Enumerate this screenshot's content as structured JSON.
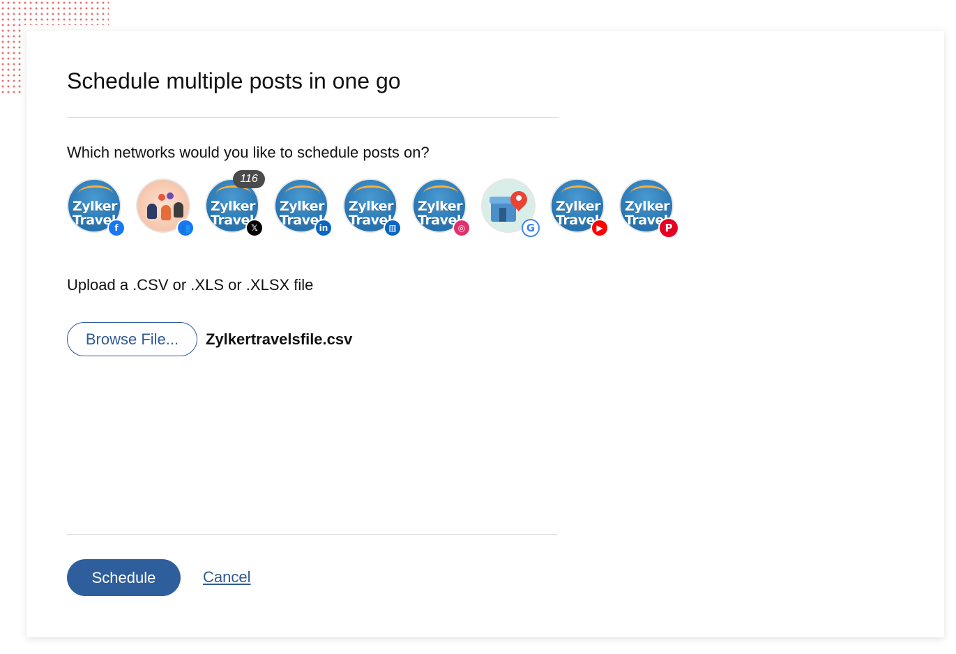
{
  "title": "Schedule multiple posts in one go",
  "networks_question": "Which networks would you like to schedule posts on?",
  "networks": [
    {
      "avatar": "Zylker Travel",
      "network": "facebook-icon",
      "badge_glyph": "f",
      "badge_color": "#1877f2"
    },
    {
      "avatar": "group-illustration",
      "network": "facebook-group-icon",
      "badge_glyph": "👥",
      "badge_color": "#1877f2"
    },
    {
      "avatar": "Zylker Travel",
      "network": "x-icon",
      "badge_glyph": "𝕏",
      "badge_color": "#000000",
      "count": "116"
    },
    {
      "avatar": "Zylker Travel",
      "network": "linkedin-icon",
      "badge_glyph": "in",
      "badge_color": "#0a66c2"
    },
    {
      "avatar": "Zylker Travel",
      "network": "linkedin-page-icon",
      "badge_glyph": "▥",
      "badge_color": "#0a66c2"
    },
    {
      "avatar": "Zylker Travel",
      "network": "instagram-icon",
      "badge_glyph": "◎",
      "badge_color": "#e1306c"
    },
    {
      "avatar": "store-map-pin",
      "network": "google-business-icon",
      "badge_glyph": "G",
      "badge_color": "#4285f4"
    },
    {
      "avatar": "Zylker Travel",
      "network": "youtube-icon",
      "badge_glyph": "▶",
      "badge_color": "#ff0000"
    },
    {
      "avatar": "Zylker Travel",
      "network": "pinterest-icon",
      "badge_glyph": "P",
      "badge_color": "#e60023"
    }
  ],
  "upload_label": "Upload a .CSV or .XLS or .XLSX file",
  "browse_label": "Browse File...",
  "file_name": "Zylkertravelsfile.csv",
  "schedule_label": "Schedule",
  "cancel_label": "Cancel",
  "colors": {
    "primary": "#2f5e9c",
    "accent_dots": "#f06a6a"
  }
}
